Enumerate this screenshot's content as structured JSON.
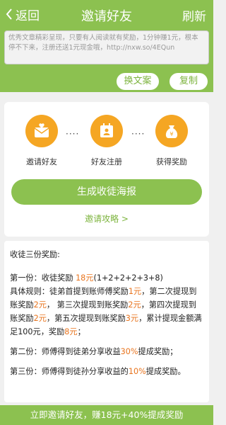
{
  "header": {
    "back_label": "返回",
    "title": "邀请好友",
    "refresh_label": "刷新"
  },
  "share_text": "优秀文章精彩呈现，只要有人阅读就有奖励，1分钟赚1元，根本停不下来，注册还送1元现金哦，http://nxw.so/4EQun",
  "buttons": {
    "change_text": "换文案",
    "copy": "复制",
    "generate_poster": "生成收徒海报"
  },
  "steps": [
    {
      "label": "邀请好友",
      "icon": "heart-envelope-icon"
    },
    {
      "label": "好友注册",
      "icon": "calendar-person-icon"
    },
    {
      "label": "获得奖励",
      "icon": "money-bag-icon"
    }
  ],
  "dots": "····",
  "guide_link": "邀请攻略 >",
  "rules": {
    "heading": "收徒三份奖励:",
    "first_label": "第一份：收徒奖励 ",
    "first_amount": "18元",
    "first_formula": "(1+2+2+2+3+8)",
    "rule_title": "具体规则：",
    "r1": "徒弟首提到账师傅奖励",
    "r1v": "1元",
    "r2a": "，第二次提现到账奖励",
    "r2v": "2元",
    "r3a": "， 第三次提现到账奖励",
    "r3v": "2元",
    "r4a": "，第四次提现到账奖励",
    "r4v": "2元",
    "r5a": "，第五次提现到账奖励",
    "r5v": "3元",
    "r6a": "，累计提现金额满足100元，奖励",
    "r6v": "8元",
    "r6b": "；",
    "second_a": "第二份：师傅得到徒弟分享收益",
    "second_v": "30%",
    "second_b": "提成奖励；",
    "third_a": "第三份：师傅得到徒孙分享收益的",
    "third_v": "10%",
    "third_b": "提成奖励。"
  },
  "footer": "立即邀请好友，赚18元+40%提成奖励",
  "colors": {
    "brand_green": "#8cc150",
    "accent_orange": "#f5a623",
    "highlight": "#e8741e"
  }
}
